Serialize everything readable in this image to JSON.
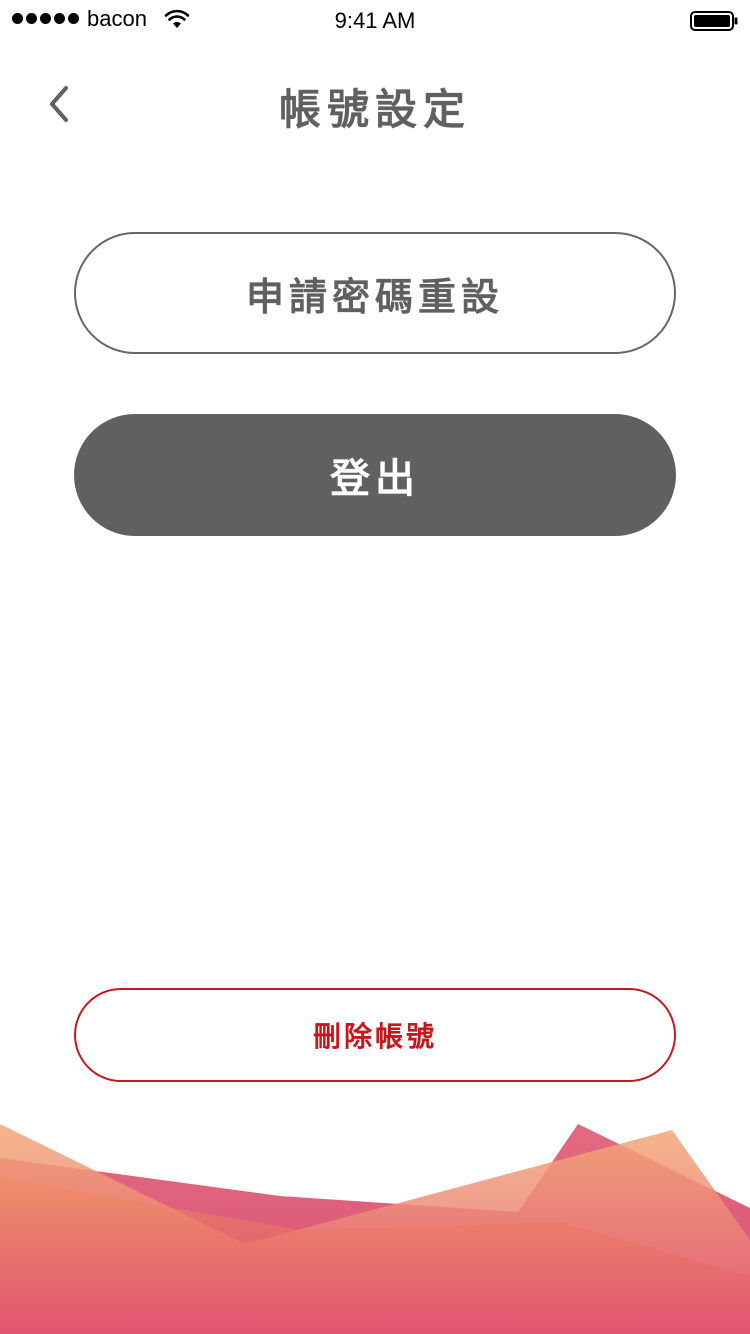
{
  "status_bar": {
    "carrier": "bacon",
    "time": "9:41 AM"
  },
  "header": {
    "title": "帳號設定",
    "back_icon": "chevron-left-icon"
  },
  "actions": {
    "reset_password_label": "申請密碼重設",
    "logout_label": "登出",
    "delete_account_label": "刪除帳號"
  },
  "colors": {
    "primary_gray": "#606060",
    "danger_red": "#c8161d",
    "wave_orange": "#f2a06e",
    "wave_pink": "#de4c6c"
  }
}
